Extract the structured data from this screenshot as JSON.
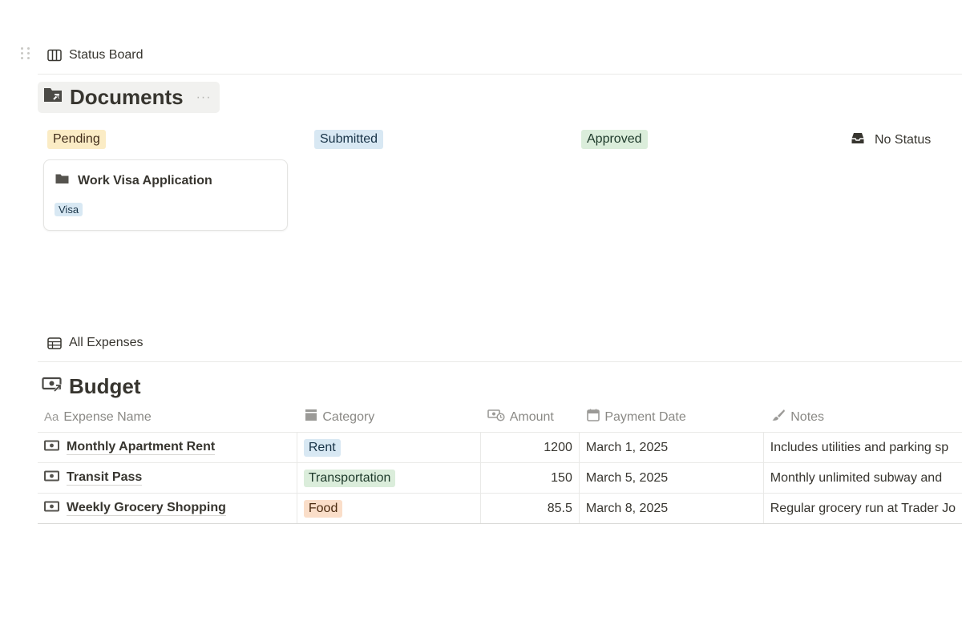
{
  "status_board": {
    "view_label": "Status Board",
    "title": "Documents",
    "more_label": "···",
    "columns": [
      {
        "label": "Pending",
        "color": "#fbecc5"
      },
      {
        "label": "Submitted",
        "color": "#d8e8f3"
      },
      {
        "label": "Approved",
        "color": "#dbeddb"
      },
      {
        "label": "No Status",
        "icon": "inbox-icon"
      }
    ],
    "cards": [
      {
        "title": "Work Visa Application",
        "icon": "folder-icon",
        "tag": "Visa"
      }
    ]
  },
  "budget": {
    "view_label": "All Expenses",
    "title": "Budget",
    "columns": [
      {
        "label": "Expense Name",
        "icon": "text-property-icon",
        "icon_text": "Aa"
      },
      {
        "label": "Category",
        "icon": "select-property-icon"
      },
      {
        "label": "Amount",
        "icon": "money-property-icon"
      },
      {
        "label": "Payment Date",
        "icon": "calendar-icon"
      },
      {
        "label": "Notes",
        "icon": "brush-icon"
      }
    ],
    "rows": [
      {
        "name": "Monthly Apartment Rent",
        "category": "Rent",
        "amount": "1200",
        "date": "March 1, 2025",
        "notes": "Includes utilities and parking sp"
      },
      {
        "name": "Transit Pass",
        "category": "Transportation",
        "amount": "150",
        "date": "March 5, 2025",
        "notes": "Monthly unlimited subway and"
      },
      {
        "name": "Weekly Grocery Shopping",
        "category": "Food",
        "amount": "85.5",
        "date": "March 8, 2025",
        "notes": "Regular grocery run at Trader Jo"
      }
    ]
  }
}
